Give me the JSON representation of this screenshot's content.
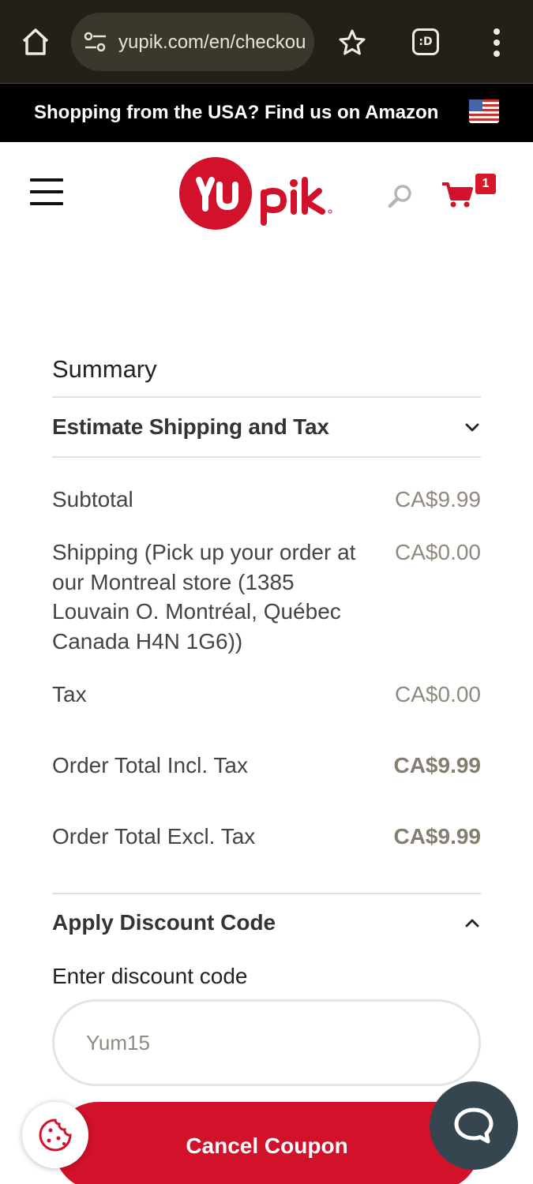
{
  "browser": {
    "url": "yupik.com/en/checkout",
    "tabs_label": ":D"
  },
  "promo": {
    "text": "Shopping from the USA? Find us on Amazon"
  },
  "header": {
    "cart_count": "1"
  },
  "summary": {
    "title": "Summary",
    "estimate_label": "Estimate Shipping and Tax",
    "rows": [
      {
        "label": "Subtotal",
        "value": "CA$9.99"
      },
      {
        "label": "Shipping (Pick up your order at our Montreal store (1385 Louvain O. Montréal, Québec Canada H4N 1G6))",
        "value": "CA$0.00"
      },
      {
        "label": "Tax",
        "value": "CA$0.00"
      },
      {
        "label": "Order Total Incl. Tax",
        "value": "CA$9.99"
      },
      {
        "label": "Order Total Excl. Tax",
        "value": "CA$9.99"
      }
    ],
    "discount_label": "Apply Discount Code",
    "discount_field_label": "Enter discount code",
    "discount_value": "Yum15",
    "cancel_label": "Cancel Coupon"
  },
  "colors": {
    "brand_red": "#d2112a",
    "chrome_bg": "#23201a",
    "chat_bg": "#354651"
  }
}
